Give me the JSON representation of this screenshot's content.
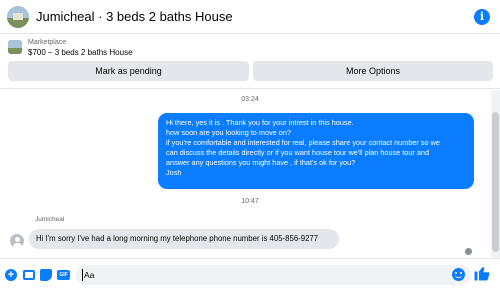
{
  "header": {
    "title": "Jumicheal · 3 beds 2 baths House",
    "info_icon": "info-icon"
  },
  "marketplace": {
    "label": "Marketplace",
    "price_title": "$700 – 3 beds 2 baths House",
    "buttons": {
      "pending": "Mark as pending",
      "more": "More Options"
    }
  },
  "chat": {
    "timestamps": [
      "03:24",
      "10:47"
    ],
    "outgoing": {
      "lines": [
        "Hi there, yes it is . Thank you for your intrest in this house.",
        "how soon are you looking to move on?",
        "if you're comfortable and interested for real, please share your contact number so we",
        "can discuss the details directly or if you  want house tour we'll plan house tour and",
        "answer any questions you might have , if that's ok for you?",
        "Josh"
      ]
    },
    "incoming": {
      "sender": "Jumicheal",
      "text": "Hi I'm sorry I've had a long morning my telephone phone number is 405-856-9277"
    }
  },
  "composer": {
    "placeholder": "Aa"
  },
  "colors": {
    "accent": "#0a7cff",
    "bubble_in": "#e4e6eb",
    "button_bg": "#e4e6eb"
  }
}
